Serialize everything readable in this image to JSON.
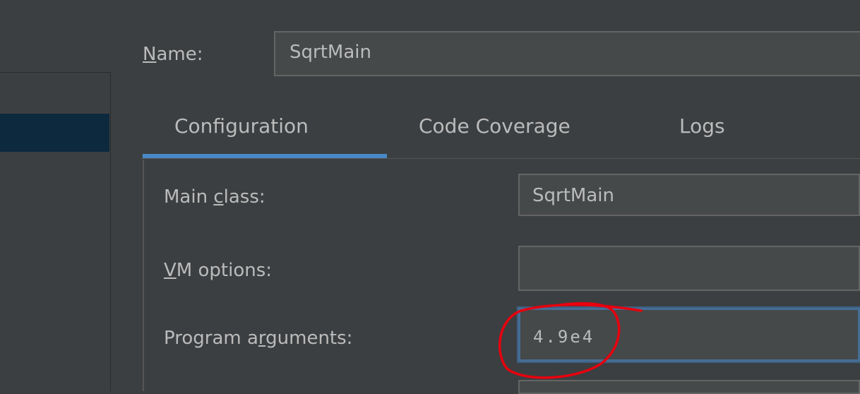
{
  "header": {
    "name_label_mnemonic": "N",
    "name_label_rest": "ame:",
    "name_value": "SqrtMain"
  },
  "tabs": [
    {
      "label": "Configuration",
      "selected": true
    },
    {
      "label": "Code Coverage",
      "selected": false
    },
    {
      "label": "Logs",
      "selected": false
    }
  ],
  "form": {
    "main_class": {
      "label_prefix": "Main ",
      "label_mnemonic": "c",
      "label_suffix": "lass:",
      "value": "SqrtMain"
    },
    "vm_options": {
      "label_mnemonic": "V",
      "label_suffix": "M options:",
      "value": ""
    },
    "program_arguments": {
      "label_prefix": "Program a",
      "label_mnemonic": "r",
      "label_suffix": "guments:",
      "value": "4.9e4"
    }
  },
  "colors": {
    "background": "#3c3f41",
    "selection": "#0d293e",
    "tab_accent": "#4a88c7",
    "annotation": "#e8000e"
  }
}
